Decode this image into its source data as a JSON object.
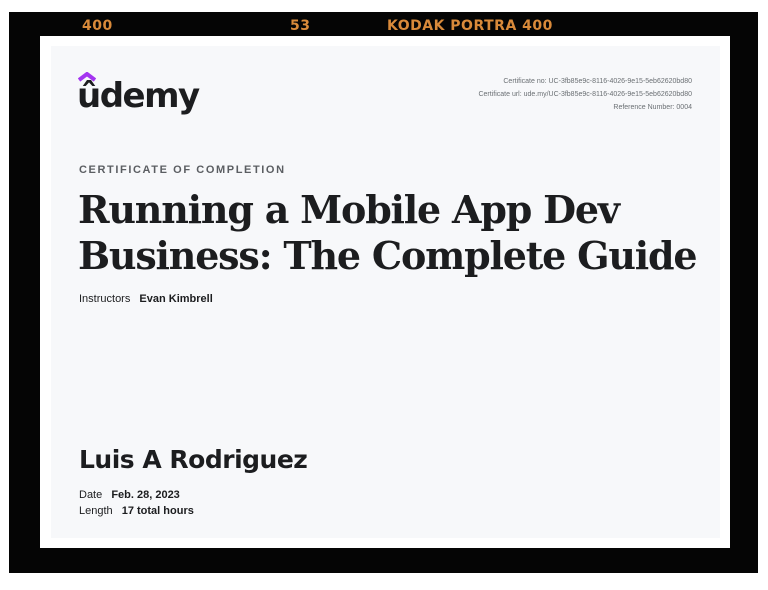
{
  "film_strip": {
    "frame_left": "400",
    "frame_number": "53",
    "brand": "KODAK  PORTRA 400"
  },
  "certificate": {
    "logo_text": "ûdemy",
    "certificate_no": "Certificate no: UC-3fb85e9c-8116-4026-9e15-5eb62620bd80",
    "certificate_url": "Certificate url: ude.my/UC-3fb85e9c-8116-4026-9e15-5eb62620bd80",
    "reference_number": "Reference Number: 0004",
    "label": "CERTIFICATE OF COMPLETION",
    "course_title_line1": "Running a Mobile App Dev",
    "course_title_line2": "Business: The Complete Guide",
    "instructors_label": "Instructors",
    "instructor_name": "Evan Kimbrell",
    "recipient_name": "Luis A Rodriguez",
    "date_label": "Date",
    "date_value": "Feb. 28, 2023",
    "length_label": "Length",
    "length_value": "17 total hours"
  },
  "colors": {
    "brand_purple": "#a435f0",
    "text_dark": "#1c1d1f",
    "film_orange": "#d98a3a"
  }
}
